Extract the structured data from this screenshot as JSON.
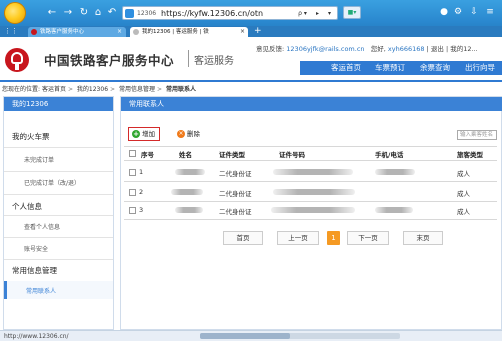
{
  "browser": {
    "address_number": "12306",
    "url": "https://kyfw.12306.cn/otn",
    "url_tail": "ρ ▾",
    "tabs": [
      {
        "label": "铁路客户服务中心"
      },
      {
        "label": "我的12306 | 客运服务 | 铁"
      }
    ],
    "status_url": "http://www.12306.cn/"
  },
  "site": {
    "title": "中国铁路客户服务中心",
    "subtitle": "客运服务",
    "user_bar": {
      "feedback_label": "意见反馈:",
      "email": "12306yjfk@rails.com.cn",
      "hello": "您好,",
      "username": "xyh666168",
      "logout": "退出",
      "my12306": "我的12..."
    },
    "nav": [
      "客运首页",
      "车票预订",
      "余票查询",
      "出行向导"
    ]
  },
  "breadcrumb": {
    "prefix": "您现在的位置:",
    "items": [
      "客运首页",
      "我的12306",
      "常用信息管理",
      "常用联系人"
    ]
  },
  "sidebar": {
    "header": "我的12306",
    "sections": [
      {
        "title": "我的火车票",
        "items": [
          "未完成订单",
          "已完成订单（改/退）"
        ]
      },
      {
        "title": "个人信息",
        "items": [
          "查看个人信息",
          "账号安全"
        ]
      },
      {
        "title": "常用信息管理",
        "items": [
          "常用联系人"
        ]
      }
    ]
  },
  "main": {
    "header": "常用联系人",
    "toolbar": {
      "add": "增加",
      "delete": "删除",
      "search_placeholder": "输入乘客姓名"
    },
    "columns": [
      "序号",
      "姓名",
      "证件类型",
      "证件号码",
      "手机/电话",
      "旅客类型"
    ],
    "rows": [
      {
        "no": "1",
        "id_type": "二代身份证",
        "passenger_type": "成人"
      },
      {
        "no": "2",
        "id_type": "二代身份证",
        "passenger_type": "成人"
      },
      {
        "no": "3",
        "id_type": "二代身份证",
        "passenger_type": "成人"
      }
    ],
    "pager": {
      "first": "首页",
      "prev": "上一页",
      "current": "1",
      "next": "下一页",
      "last": "末页"
    }
  },
  "colors": {
    "brand_red": "#c8161d",
    "nav_blue": "#2f7ad2",
    "panel_blue": "#3b82d6",
    "add_green": "#2da52d",
    "delete_orange": "#f07a1a",
    "pager_orange": "#f59a23",
    "highlight_red": "#d42a2a"
  },
  "icons": [
    "browser-logo-icon",
    "back-icon",
    "forward-icon",
    "refresh-icon",
    "home-icon",
    "undo-icon",
    "shield-icon",
    "apps-icon",
    "tab-favicon",
    "close-icon",
    "new-tab-icon",
    "rail-logo-icon",
    "add-icon",
    "delete-icon",
    "checkbox-icon"
  ]
}
